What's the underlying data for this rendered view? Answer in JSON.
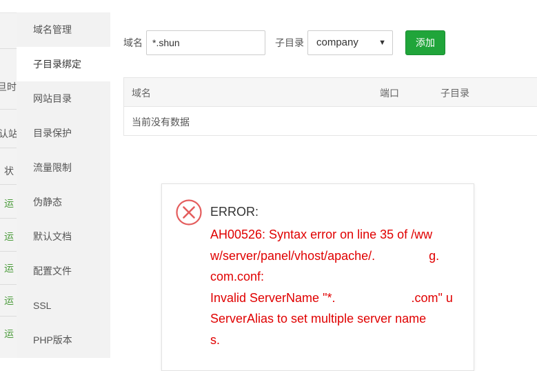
{
  "background": {
    "snippets": [
      "旦时",
      "认站",
      "状",
      "运",
      "运",
      "运",
      "运",
      "运"
    ]
  },
  "sidebar": {
    "items": [
      {
        "label": "域名管理",
        "active": false
      },
      {
        "label": "子目录绑定",
        "active": true
      },
      {
        "label": "网站目录",
        "active": false
      },
      {
        "label": "目录保护",
        "active": false
      },
      {
        "label": "流量限制",
        "active": false
      },
      {
        "label": "伪静态",
        "active": false
      },
      {
        "label": "默认文档",
        "active": false
      },
      {
        "label": "配置文件",
        "active": false
      },
      {
        "label": "SSL",
        "active": false
      },
      {
        "label": "PHP版本",
        "active": false
      }
    ]
  },
  "form": {
    "domain_label": "域名",
    "domain_value": "*.shun",
    "subdir_label": "子目录",
    "subdir_selected": "company",
    "add_button": "添加"
  },
  "table": {
    "columns": [
      "域名",
      "端口",
      "子目录"
    ],
    "empty_text": "当前没有数据"
  },
  "error": {
    "title": "ERROR:",
    "lines": [
      "AH00526: Syntax error on line 35 of /ww",
      "w/server/panel/vhost/apache/.",
      "com.conf:",
      "Invalid ServerName \"*.",
      "ServerAlias to set multiple server name",
      "s."
    ],
    "line2_tail": "g.",
    "line4_tail": ".com\" u",
    "line5_prefix": ""
  },
  "colors": {
    "accent_green": "#20a53a",
    "error_red": "#e00000"
  }
}
